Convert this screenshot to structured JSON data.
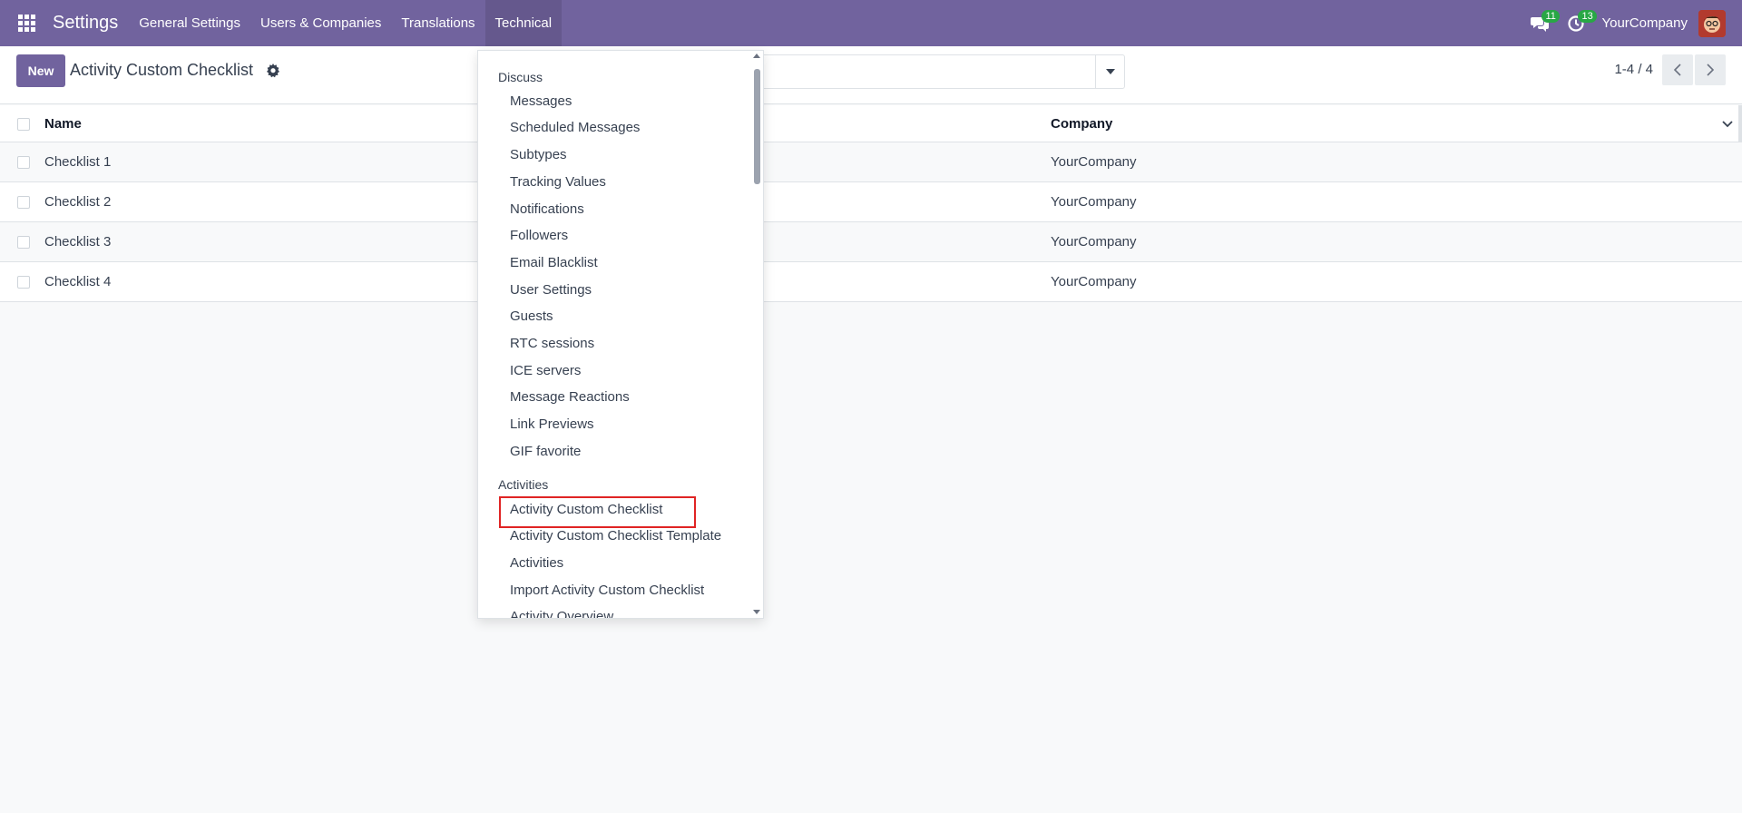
{
  "navbar": {
    "brand": "Settings",
    "menu": [
      "General Settings",
      "Users & Companies",
      "Translations",
      "Technical"
    ],
    "active_index": 3,
    "messages_count": "11",
    "activities_count": "13",
    "company": "YourCompany"
  },
  "control_panel": {
    "new_label": "New",
    "title": "Activity Custom Checklist",
    "pager": "1-4 / 4"
  },
  "list": {
    "columns": [
      "Name",
      "Company"
    ],
    "rows": [
      {
        "name": "Checklist 1",
        "company": "YourCompany"
      },
      {
        "name": "Checklist 2",
        "company": "YourCompany"
      },
      {
        "name": "Checklist 3",
        "company": "YourCompany"
      },
      {
        "name": "Checklist 4",
        "company": "YourCompany"
      }
    ]
  },
  "dropdown": {
    "sections": [
      {
        "title": "Discuss",
        "items": [
          "Messages",
          "Scheduled Messages",
          "Subtypes",
          "Tracking Values",
          "Notifications",
          "Followers",
          "Email Blacklist",
          "User Settings",
          "Guests",
          "RTC sessions",
          "ICE servers",
          "Message Reactions",
          "Link Previews",
          "GIF favorite"
        ]
      },
      {
        "title": "Activities",
        "items": [
          "Activity Custom Checklist",
          "Activity Custom Checklist Template",
          "Activities",
          "Import Activity Custom Checklist",
          "Activity Overview"
        ]
      }
    ],
    "highlighted_item": "Activity Custom Checklist"
  },
  "colors": {
    "navbar": "#71639e",
    "highlight_border": "#e02424",
    "badge": "#28a745"
  }
}
